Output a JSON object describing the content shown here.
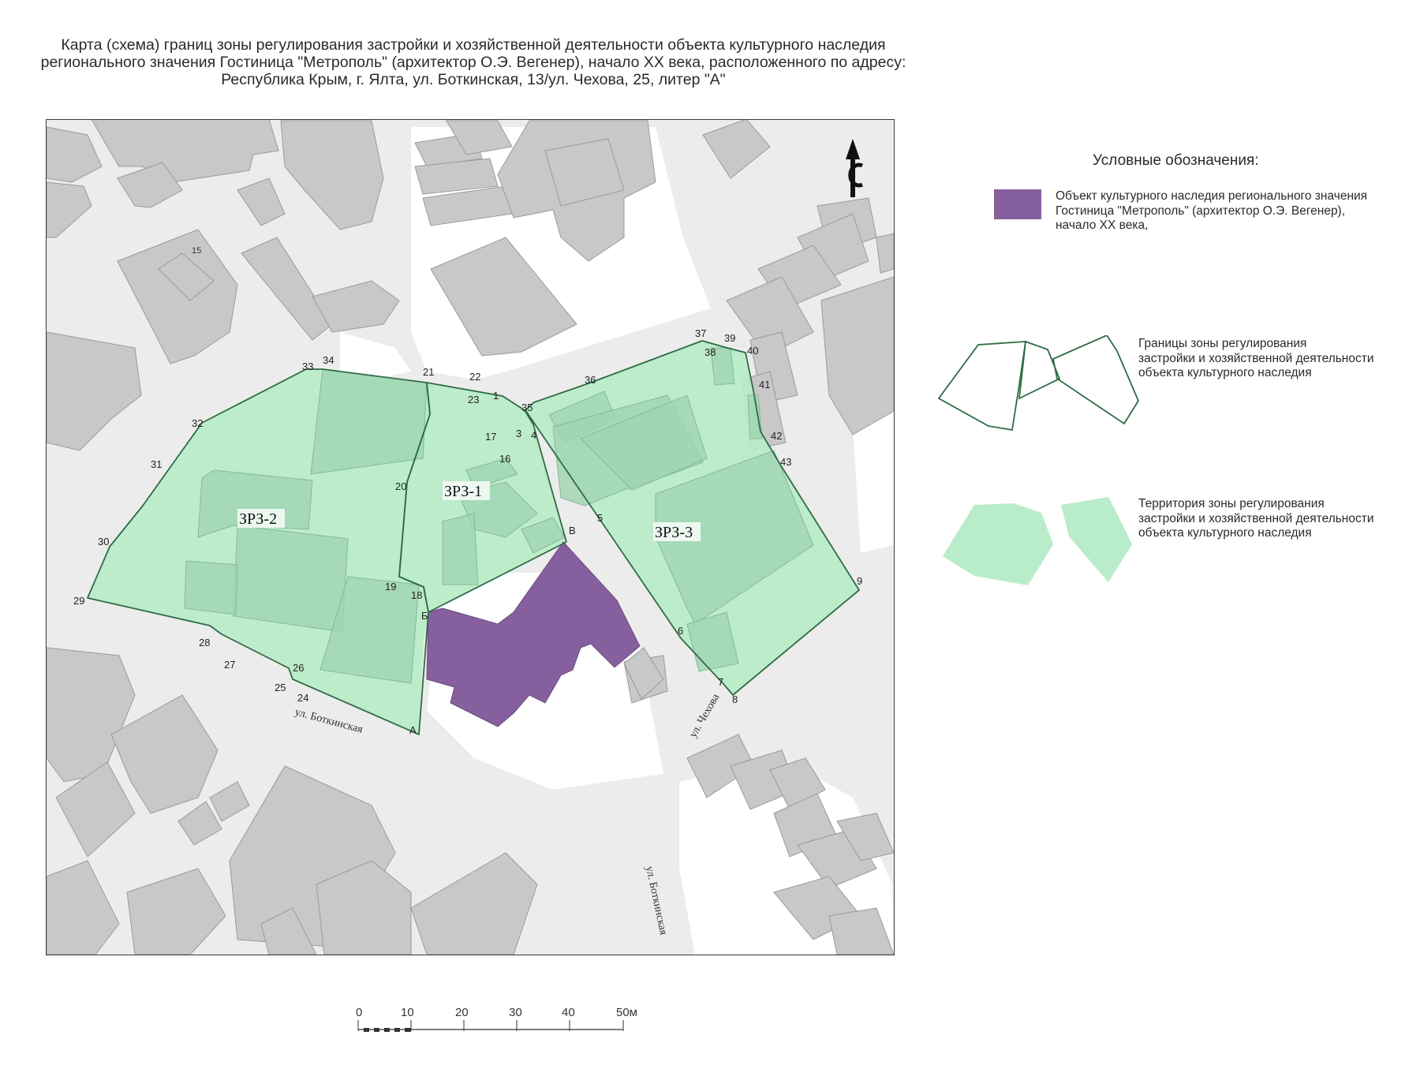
{
  "title": {
    "line1": "Карта (схема) границ зоны регулирования застройки и хозяйственной деятельности объекта культурного наследия",
    "line2": "регионального значения Гостиница \"Метрополь\" (архитектор О.Э. Вегенер), начало XX века, расположенного по адресу:",
    "line3": "Республика Крым, г. Ялта, ул. Боткинская, 13/ул. Чехова, 25, литер \"А\""
  },
  "map": {
    "zones": [
      {
        "label": "ЗРЗ-1"
      },
      {
        "label": "ЗРЗ-2"
      },
      {
        "label": "ЗРЗ-3"
      }
    ],
    "streets": [
      "ул. Боткинская",
      "ул. Чехова",
      "ул. Боткинская"
    ],
    "building_number": "15",
    "point_labels": [
      "1",
      "3",
      "4",
      "5",
      "6",
      "7",
      "8",
      "9",
      "16",
      "17",
      "18",
      "19",
      "20",
      "21",
      "22",
      "23",
      "24",
      "25",
      "26",
      "27",
      "28",
      "29",
      "30",
      "31",
      "32",
      "33",
      "34",
      "35",
      "36",
      "37",
      "38",
      "39",
      "40",
      "41",
      "42",
      "43",
      "А",
      "Б",
      "В"
    ],
    "colors": {
      "zone_fill": "#b9ecc8",
      "zone_stroke": "#2f6b45",
      "heritage_object": "#86609e",
      "building": "#c8c8c8",
      "road": "#ececec",
      "open_area": "#ffffff"
    }
  },
  "legend": {
    "title": "Условные обозначения:",
    "items": [
      {
        "lines": [
          "Объект культурного наследия регионального значения",
          "Гостиница \"Метрополь\" (архитектор О.Э. Вегенер),",
          "начало XX века,"
        ]
      },
      {
        "lines": [
          "Границы зоны регулирования",
          "застройки и хозяйственной деятельности",
          "объекта культурного наследия"
        ]
      },
      {
        "lines": [
          "Территория зоны регулирования",
          "застройки и хозяйственной деятельности",
          "объекта культурного наследия"
        ]
      }
    ]
  },
  "scale": {
    "ticks": [
      "0",
      "10",
      "20",
      "30",
      "40",
      "50м"
    ]
  }
}
